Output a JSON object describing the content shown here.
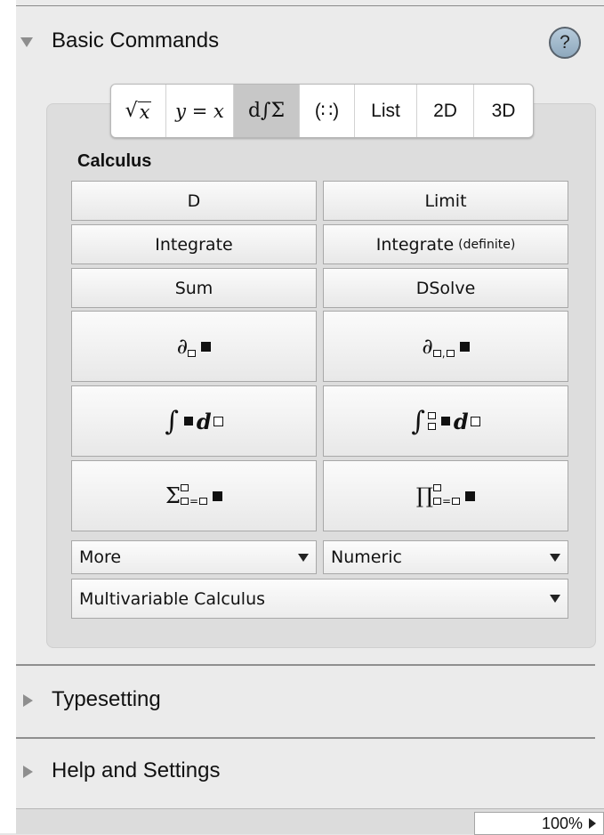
{
  "panel": {
    "sections": {
      "basic_commands": "Basic Commands",
      "typesetting": "Typesetting",
      "help_and_settings": "Help and Settings"
    },
    "help_label": "?",
    "tabs": {
      "sqrt_x": "x",
      "y_equals_x": "y = x",
      "calculus": "d∫Σ",
      "matrix": "(∷)",
      "list": "List",
      "two_d": "2D",
      "three_d": "3D"
    },
    "active_tab": "calculus",
    "group_label": "Calculus",
    "buttons": {
      "d": "D",
      "limit": "Limit",
      "integrate": "Integrate",
      "integrate_definite": "Integrate",
      "integrate_definite_note": "(definite)",
      "sum": "Sum",
      "dsolve": "DSolve"
    },
    "templates": {
      "partial": "∂",
      "integral": "∫",
      "d": "d",
      "sum": "Σ",
      "product": "∏",
      "equals": "="
    },
    "dropdowns": {
      "more": "More",
      "numeric": "Numeric",
      "multivariable": "Multivariable Calculus"
    },
    "zoom": "100%"
  },
  "colors": {
    "panel_bg": "#ebebeb",
    "active_tab": "#c7c7c7",
    "help_button": "#a3bad0"
  }
}
